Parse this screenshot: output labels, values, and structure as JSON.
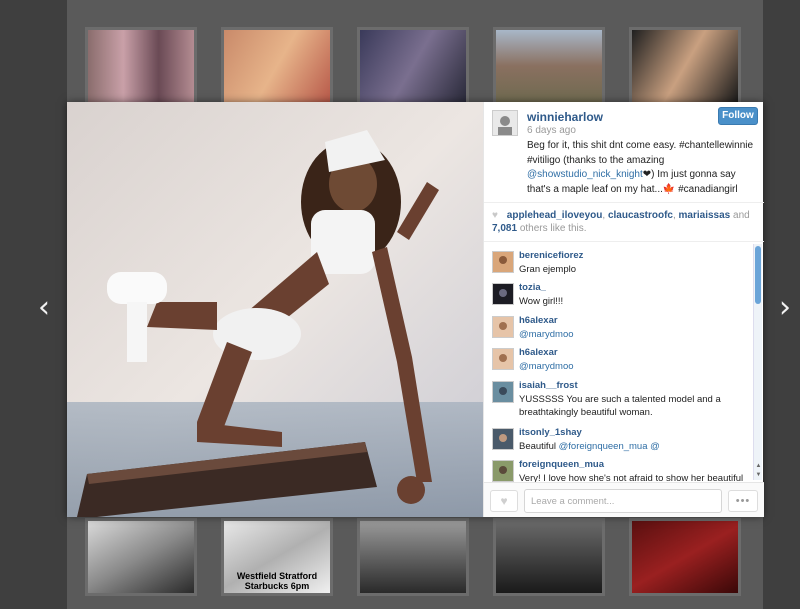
{
  "post": {
    "username": "winnieharlow",
    "time_ago": "6 days ago",
    "follow_label": "Follow",
    "caption_1": "Beg for it, this shit dnt come easy. #chantellewinnie #vitiligo (thanks to the amazing",
    "caption_link": "@showstudio_nick_knight",
    "caption_2": "❤) Im just gonna say that's a maple leaf on my hat...🍁 #canadiangirl"
  },
  "likes": {
    "user_1": "applehead_iloveyou",
    "user_2": "claucastroofc",
    "user_3": "mariaissas",
    "and_text": "and",
    "count": "7,081",
    "suffix": "others like this."
  },
  "comments": [
    {
      "user": "berenicefiorez",
      "text": "Gran ejemplo"
    },
    {
      "user": "tozia_",
      "text": "Wow girl!!!"
    },
    {
      "user": "h6alexar",
      "text": "@marydmoo"
    },
    {
      "user": "h6alexar",
      "text": "@marydmoo"
    },
    {
      "user": "isaiah__frost",
      "text": "YUSSSSS You are such a talented model and a breathtakingly beautiful woman."
    },
    {
      "user": "itsonly_1shay",
      "text_prefix": "Beautiful",
      "text_link": "@foreignqueen_mua @"
    },
    {
      "user": "foreignqueen_mua",
      "text": "Very! I love how she's not afraid to show her beautiful"
    }
  ],
  "footer": {
    "comment_placeholder": "Leave a comment...",
    "more_label": "•••"
  },
  "nav": {
    "prev_icon": "‹",
    "next_icon": "›"
  },
  "background": {
    "thumb_caption": "Westfield Stratford Starbucks 6pm"
  },
  "colors": {
    "link": "#2f5a8a",
    "follow_button": "#4a90c9",
    "scroll_thumb": "#6aa4d8"
  }
}
